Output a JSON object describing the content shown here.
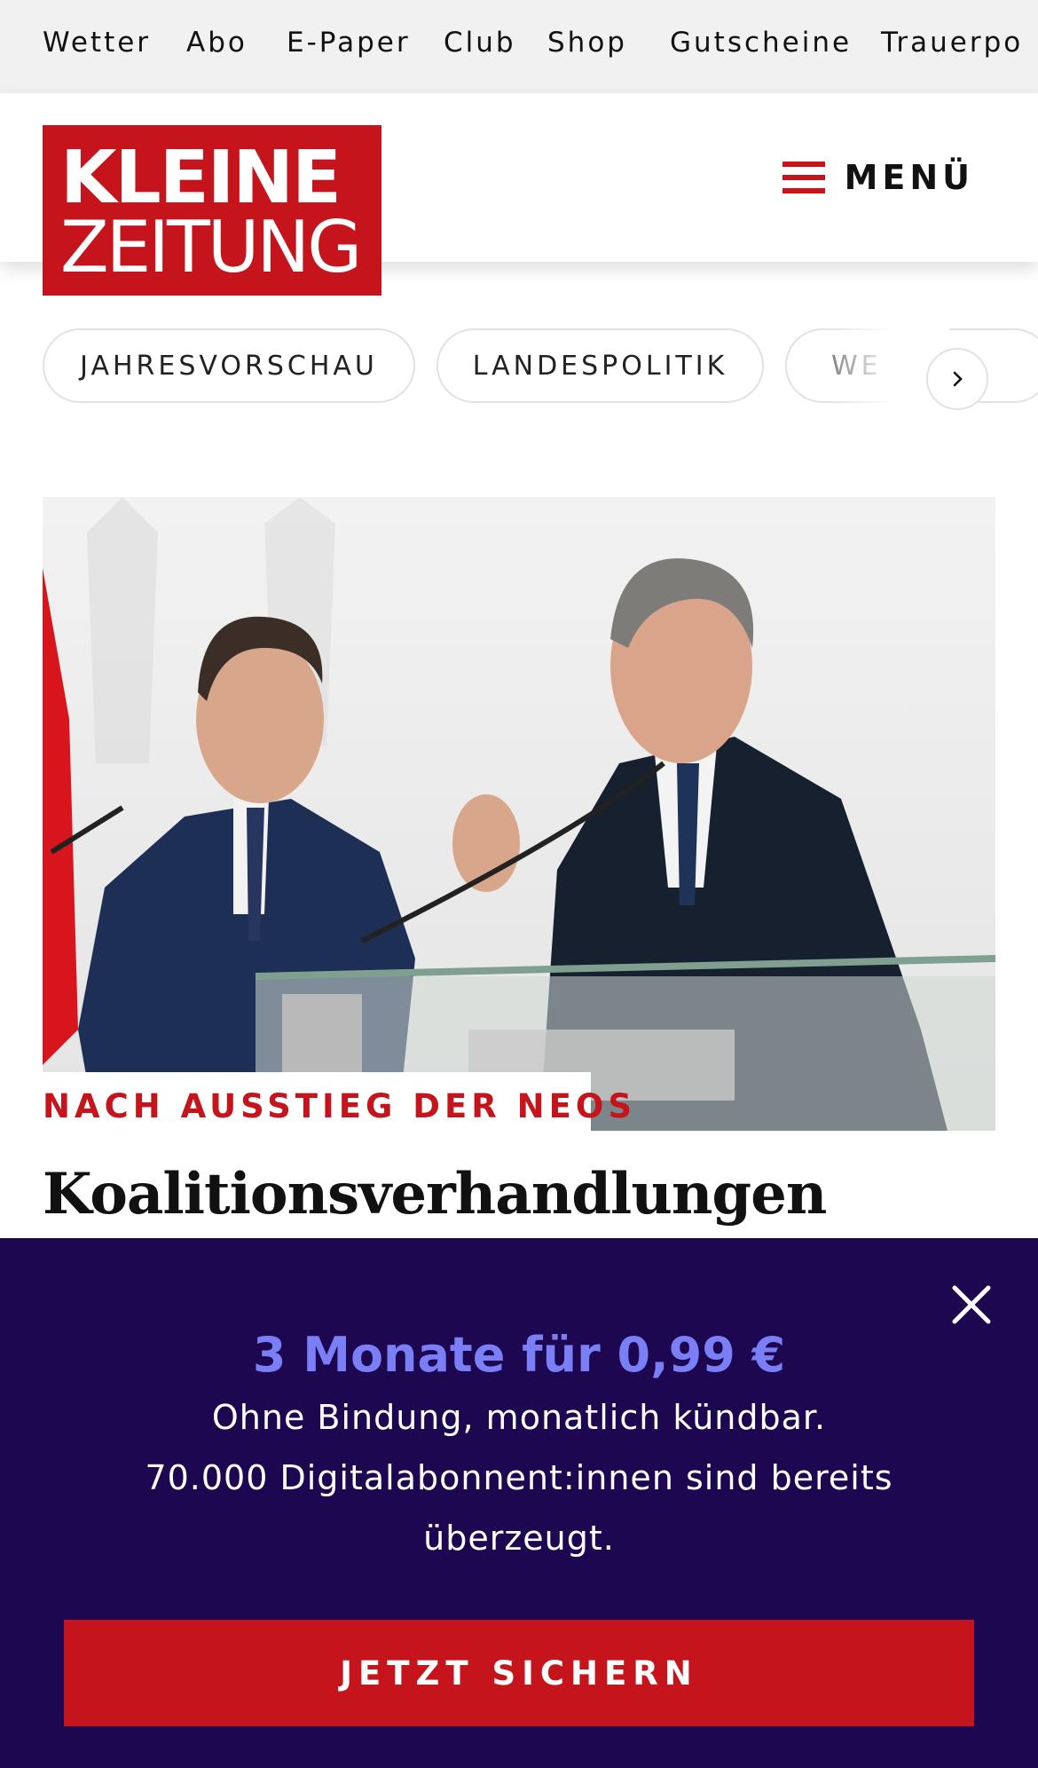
{
  "topnav": {
    "items": [
      "Wetter",
      "Abo",
      "E-Paper",
      "Club",
      "Shop",
      "Gutscheine",
      "Trauerpo"
    ]
  },
  "header": {
    "logo": {
      "line1": "KLEINE",
      "line2": "ZEITUNG"
    },
    "menu_label": "MENÜ",
    "brand_color": "#c5141b"
  },
  "chips": {
    "items": [
      "JAHRESVORSCHAU",
      "LANDESPOLITIK",
      "WE"
    ]
  },
  "article": {
    "kicker": "NACH AUSSTIEG DER NEOS",
    "headline": "Koalitionsverhandlungen"
  },
  "promo": {
    "title": "3 Monate für 0,99 €",
    "line1": "Ohne Bindung, monatlich kündbar.",
    "line2": "70.000 Digitalabonnent:innen sind bereits",
    "line3": "überzeugt.",
    "cta": "JETZT SICHERN",
    "background": "#1d0750",
    "accent": "#7b7ff5"
  }
}
